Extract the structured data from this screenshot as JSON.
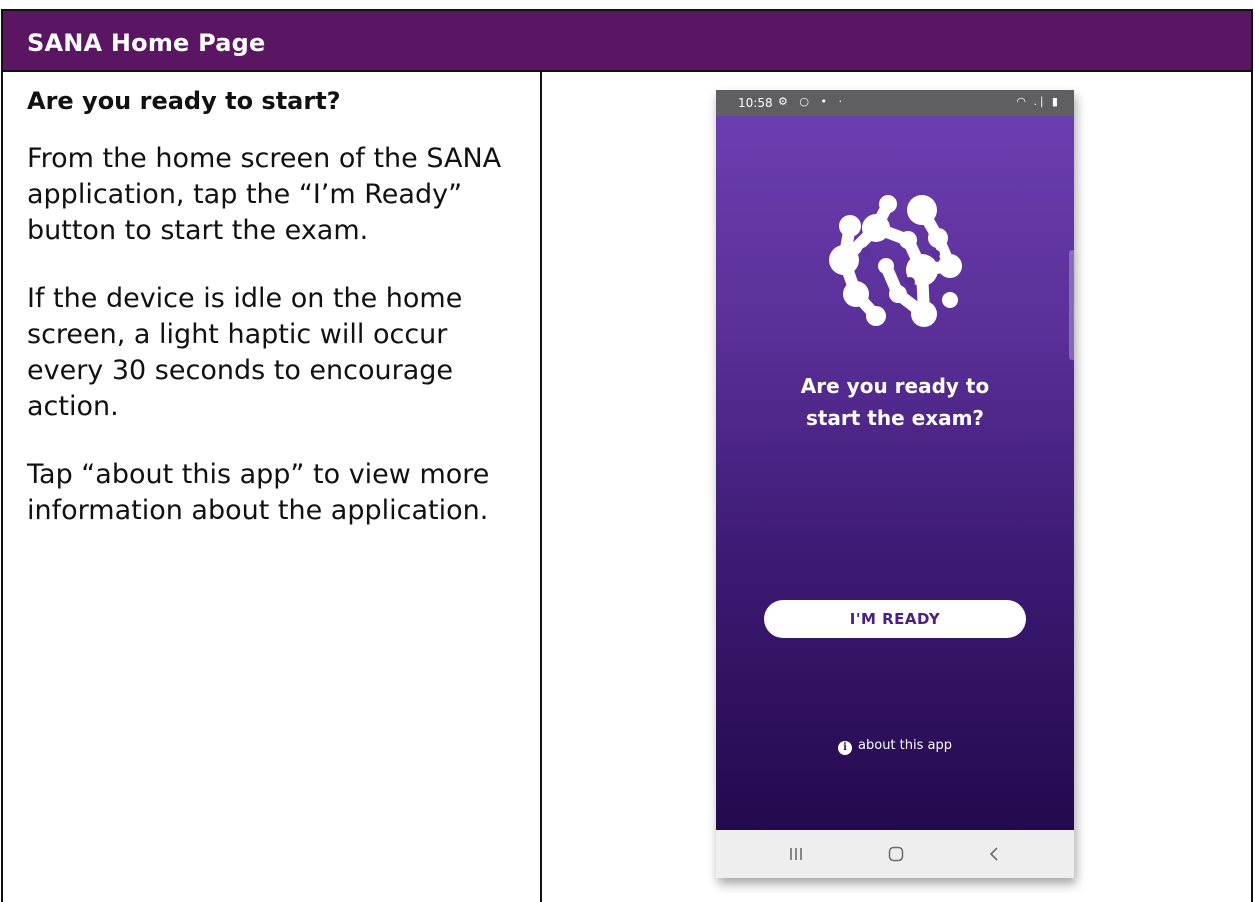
{
  "doc": {
    "header_title": "SANA Home Page",
    "sub_heading": "Are you ready to start?",
    "paragraphs": [
      "From the home screen of the SANA application, tap the “I’m Ready” button to start the exam.",
      "If the device is idle on the home screen, a light haptic will occur every 30 seconds to encourage action.",
      "Tap “about this app” to view more information about the application."
    ],
    "header_color": "#5a1563"
  },
  "phone": {
    "status": {
      "time": "10:58",
      "left_icons": "⚙ ○ • ·",
      "right_icons": "◠ .∣ ▮"
    },
    "prompt_line1": "Are you ready to",
    "prompt_line2": "start the exam?",
    "ready_button": "I'M READY",
    "about_link": "about this app",
    "info_glyph": "i",
    "nav": [
      "recents-icon",
      "home-icon",
      "back-icon"
    ],
    "colors": {
      "gradient_top": "#6e3fb2",
      "gradient_bottom": "#1f0646",
      "button_text": "#4b1f86"
    }
  }
}
